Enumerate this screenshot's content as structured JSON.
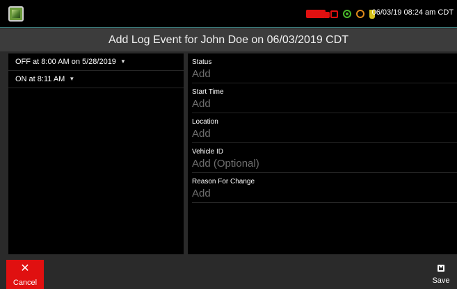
{
  "status_bar": {
    "icons": [
      "app-icon",
      "truck-icon",
      "calendar-icon",
      "gps-icon",
      "signal-icon",
      "plug-icon"
    ],
    "datetime": "06/03/19 08:24 am CDT",
    "colors": {
      "alert": "#e01010",
      "gps": "#4ab82a",
      "signal": "#e08a1a",
      "power": "#d6c21a"
    }
  },
  "header": {
    "title": "Add Log Event for John Doe on 06/03/2019 CDT"
  },
  "log_events": [
    {
      "label": "OFF at 8:00 AM on 5/28/2019"
    },
    {
      "label": "ON at 8:11 AM"
    }
  ],
  "form": {
    "fields": [
      {
        "label": "Status",
        "placeholder": "Add"
      },
      {
        "label": "Start Time",
        "placeholder": "Add"
      },
      {
        "label": "Location",
        "placeholder": "Add"
      },
      {
        "label": "Vehicle ID",
        "placeholder": "Add (Optional)"
      },
      {
        "label": "Reason For Change",
        "placeholder": "Add"
      }
    ]
  },
  "actions": {
    "cancel_label": "Cancel",
    "cancel_icon": "close-icon",
    "save_label": "Save",
    "save_icon": "floppy-disk-icon",
    "cancel_color": "#e01010"
  }
}
